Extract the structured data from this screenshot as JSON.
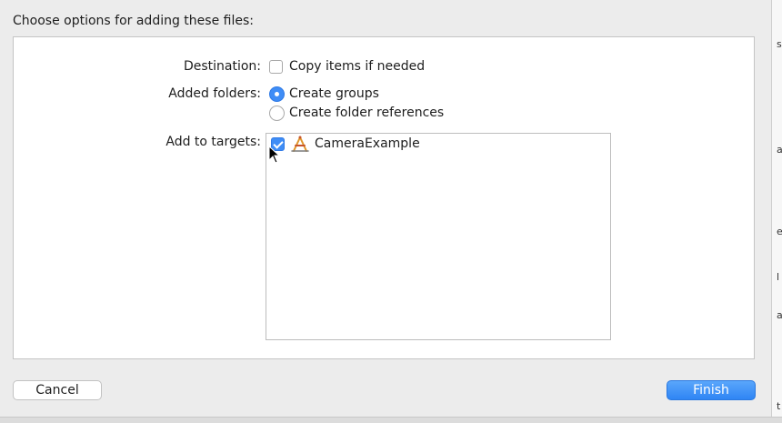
{
  "dialog": {
    "title": "Choose options for adding these files:"
  },
  "destination": {
    "label": "Destination:",
    "option_label": "Copy items if needed",
    "checked": false
  },
  "added_folders": {
    "label": "Added folders:",
    "options": [
      {
        "label": "Create groups",
        "selected": true
      },
      {
        "label": "Create folder references",
        "selected": false
      }
    ]
  },
  "targets": {
    "label": "Add to targets:",
    "items": [
      {
        "name": "CameraExample",
        "checked": true,
        "icon": "app-target-icon"
      }
    ]
  },
  "buttons": {
    "cancel": "Cancel",
    "finish": "Finish"
  },
  "background_window": {
    "fragments": [
      "s",
      "a",
      "e",
      "l",
      "a",
      "t"
    ]
  },
  "colors": {
    "accent": "#3f8df6"
  }
}
